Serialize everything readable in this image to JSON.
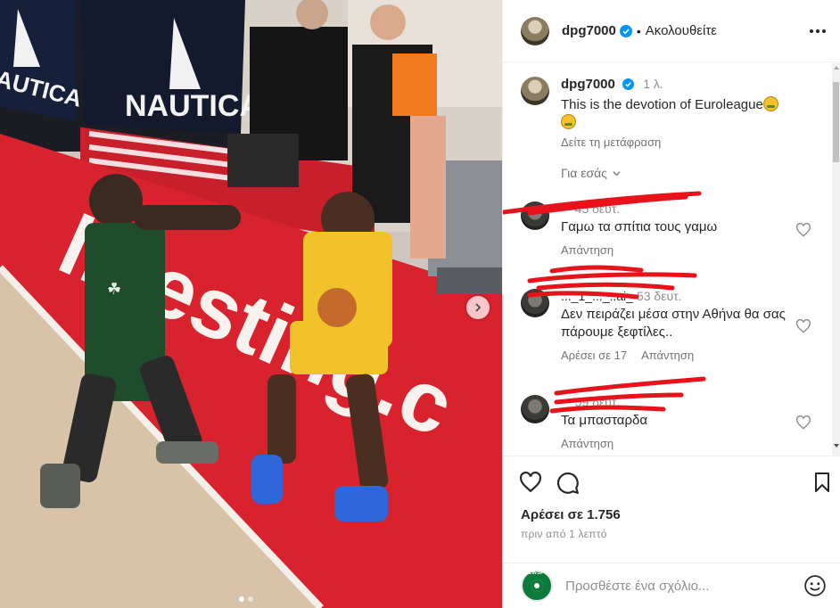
{
  "post": {
    "username": "dpg7000",
    "follow_state": "Ακολουθείτε",
    "separator": "•",
    "caption_time": "1 λ.",
    "caption_text": "This is the devotion of Euroleague",
    "translate_label": "Δείτε τη μετάφραση",
    "for_you_label": "Για εσάς"
  },
  "media": {
    "banner_text": "NAUTICA",
    "banner_text_left": "AUTICA",
    "court_logo": "livesting.c",
    "dots": 2
  },
  "comments": [
    {
      "user": "...",
      "time": "45 δευτ.",
      "text": "Γαμω τα σπίτια τους γαμω",
      "likes_label": "",
      "reply_label": "Απάντηση"
    },
    {
      "user": "..._1_..._..ai_",
      "time": "53 δευτ.",
      "text": "Δεν πειράζει μέσα στην Αθήνα θα σας πάρουμε ξεφτίλες..",
      "likes_label": "Αρέσει σε 17",
      "reply_label": "Απάντηση"
    },
    {
      "user": "...",
      "time": "59 δευτ.",
      "text": "Τα μπασταρδα",
      "likes_label": "",
      "reply_label": "Απάντηση"
    }
  ],
  "footer": {
    "likes_text": "Αρέσει σε 1.756",
    "posted_ago": "πριν από 1 λεπτό",
    "comment_placeholder": "Προσθέστε ένα σχόλιο...",
    "my_avatar_text": "NEWSPOR"
  },
  "colors": {
    "court_red": "#d8232e",
    "panathinaikos_green": "#1f4d2c",
    "maccabi_yellow": "#f2c22a",
    "referee_orange": "#f07a1e",
    "verified_blue": "#0095f6",
    "scribble_red": "#e8131a"
  }
}
